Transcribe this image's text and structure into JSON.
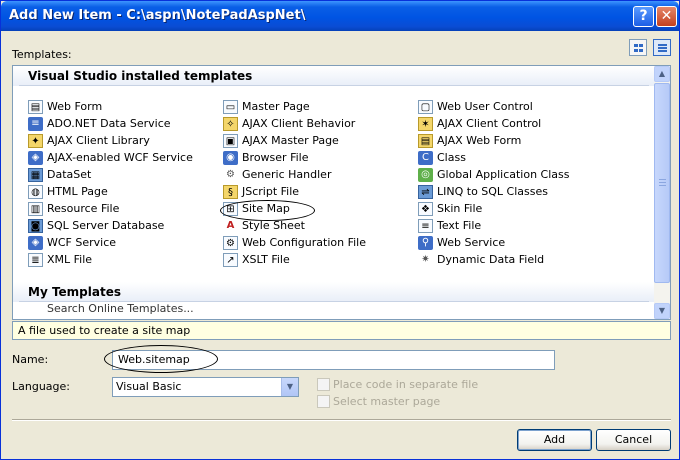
{
  "window": {
    "title": "Add New Item - C:\\aspn\\NotePadAspNet\\",
    "help_glyph": "?",
    "close_glyph": "✕"
  },
  "templates_label": "Templates:",
  "groups": {
    "installed": "Visual Studio installed templates",
    "my": "My Templates"
  },
  "columns": [
    [
      {
        "label": "Web Form",
        "icon": "web-form-icon"
      },
      {
        "label": "ADO.NET Data Service",
        "icon": "data-service-icon"
      },
      {
        "label": "AJAX Client Library",
        "icon": "ajax-library-icon"
      },
      {
        "label": "AJAX-enabled WCF Service",
        "icon": "wcf-service-icon"
      },
      {
        "label": "DataSet",
        "icon": "dataset-icon"
      },
      {
        "label": "HTML Page",
        "icon": "html-page-icon"
      },
      {
        "label": "Resource File",
        "icon": "resource-file-icon"
      },
      {
        "label": "SQL Server Database",
        "icon": "database-icon"
      },
      {
        "label": "WCF Service",
        "icon": "wcf-service-icon"
      },
      {
        "label": "XML File",
        "icon": "xml-file-icon"
      }
    ],
    [
      {
        "label": "Master Page",
        "icon": "master-page-icon"
      },
      {
        "label": "AJAX Client Behavior",
        "icon": "ajax-behavior-icon"
      },
      {
        "label": "AJAX Master Page",
        "icon": "ajax-master-page-icon"
      },
      {
        "label": "Browser File",
        "icon": "browser-file-icon"
      },
      {
        "label": "Generic Handler",
        "icon": "handler-icon"
      },
      {
        "label": "JScript File",
        "icon": "jscript-file-icon"
      },
      {
        "label": "Site Map",
        "icon": "site-map-icon"
      },
      {
        "label": "Style Sheet",
        "icon": "style-sheet-icon"
      },
      {
        "label": "Web Configuration File",
        "icon": "web-config-icon"
      },
      {
        "label": "XSLT File",
        "icon": "xslt-file-icon"
      }
    ],
    [
      {
        "label": "Web User Control",
        "icon": "user-control-icon"
      },
      {
        "label": "AJAX Client Control",
        "icon": "ajax-control-icon"
      },
      {
        "label": "AJAX Web Form",
        "icon": "ajax-web-form-icon"
      },
      {
        "label": "Class",
        "icon": "class-icon"
      },
      {
        "label": "Global Application Class",
        "icon": "global-class-icon"
      },
      {
        "label": "LINQ to SQL Classes",
        "icon": "linq-icon"
      },
      {
        "label": "Skin File",
        "icon": "skin-file-icon"
      },
      {
        "label": "Text File",
        "icon": "text-file-icon"
      },
      {
        "label": "Web Service",
        "icon": "web-service-icon"
      },
      {
        "label": "Dynamic Data Field",
        "icon": "dynamic-data-icon"
      }
    ]
  ],
  "selected_template": "Site Map",
  "my_templates_partial": "Search Online Templates...",
  "description": "A file used to create a site map",
  "name_label": "Name:",
  "name_value": "Web.sitemap",
  "language_label": "Language:",
  "language_value": "Visual Basic",
  "place_code_label": "Place code in separate file",
  "master_page_label": "Select master page",
  "add_label": "Add",
  "cancel_label": "Cancel",
  "colors": {
    "titlebar": "#0054e3",
    "dialog_bg": "#ece9d8",
    "disabled_text": "#aca899",
    "description_bg": "#ffffe1"
  }
}
